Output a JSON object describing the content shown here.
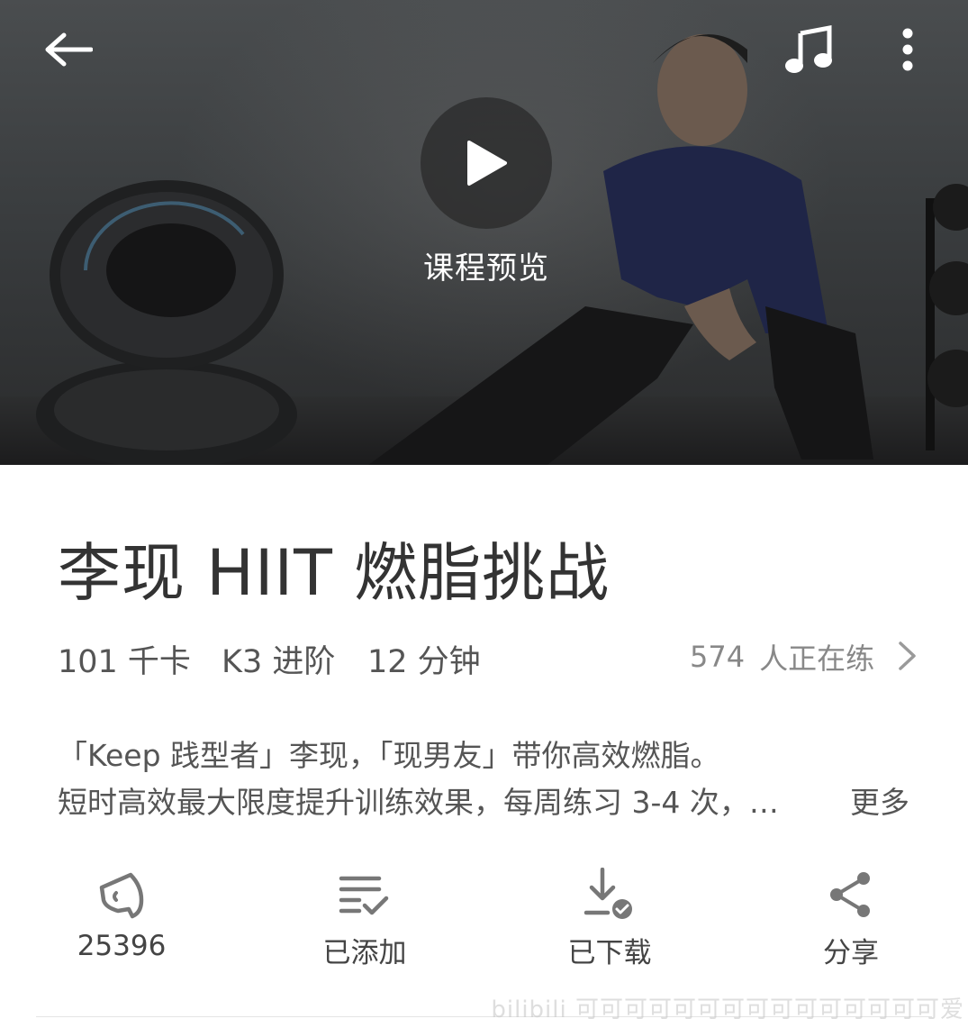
{
  "hero": {
    "preview_label": "课程预览",
    "icons": {
      "back": "back-arrow-icon",
      "music": "music-note-icon",
      "more": "more-vertical-icon",
      "play": "play-icon"
    }
  },
  "course": {
    "title": "李现 HIIT 燃脂挑战",
    "kcal": "101 千卡",
    "level": "K3 进阶",
    "duration": "12 分钟",
    "practicing_count": "574",
    "practicing_label": "人正在练"
  },
  "description": {
    "line1": "「Keep 践型者」李现，「现男友」带你高效燃脂。",
    "line2": "短时高效最大限度提升训练效果，每周练习 3-4 次，…",
    "more_label": "更多"
  },
  "actions": [
    {
      "label": "25396",
      "icon": "cheer-icon"
    },
    {
      "label": "已添加",
      "icon": "playlist-added-icon"
    },
    {
      "label": "已下载",
      "icon": "downloaded-icon"
    },
    {
      "label": "分享",
      "icon": "share-icon"
    }
  ],
  "watermark": "bilibili 可可可可可可可可可可可可可可可爱",
  "colors": {
    "text_primary": "#333333",
    "text_secondary": "#888888",
    "hero_dark": "#3a3d3f"
  }
}
